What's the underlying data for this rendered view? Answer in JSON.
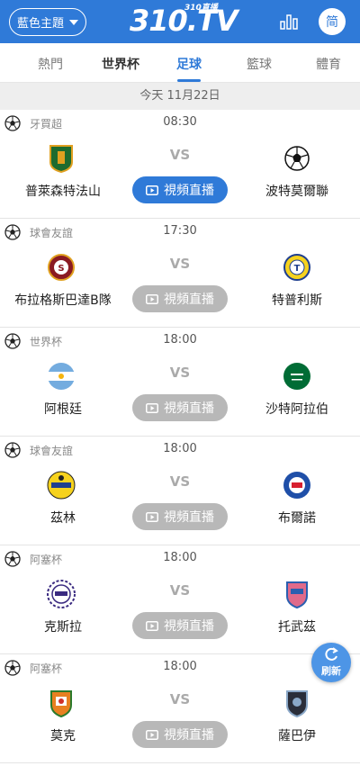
{
  "header": {
    "theme_label": "藍色主題",
    "logo_text": "310.TV",
    "logo_sub": "310直播",
    "lang_label": "简"
  },
  "tabs": [
    "熱門",
    "世界杯",
    "足球",
    "籃球",
    "體育"
  ],
  "active_tab": "足球",
  "date_label": "今天 11月22日",
  "live_label": "視頻直播",
  "vs_label": "VS",
  "refresh_label": "刷新",
  "colors": {
    "brand": "#2f7ad8",
    "button_off": "#b8b8b8"
  },
  "matches": [
    {
      "league": "牙買超",
      "time": "08:30",
      "home": "普萊森特法山",
      "away": "波特莫爾聯",
      "live": true,
      "home_icon": "green-shield-crest-icon",
      "away_icon": "soccer-ball-crest-icon"
    },
    {
      "league": "球會友誼",
      "time": "17:30",
      "home": "布拉格斯巴達B隊",
      "away": "特普利斯",
      "live": false,
      "home_icon": "sparta-red-crest-icon",
      "away_icon": "yellow-round-crest-icon"
    },
    {
      "league": "世界杯",
      "time": "18:00",
      "home": "阿根廷",
      "away": "沙特阿拉伯",
      "live": false,
      "home_icon": "argentina-flag-icon",
      "away_icon": "saudi-flag-icon"
    },
    {
      "league": "球會友誼",
      "time": "18:00",
      "home": "茲林",
      "away": "布爾諾",
      "live": false,
      "home_icon": "yellow-crest-icon",
      "away_icon": "blue-red-crest-icon"
    },
    {
      "league": "阿塞杯",
      "time": "18:00",
      "home": "克斯拉",
      "away": "托武茲",
      "live": false,
      "home_icon": "inter-crest-icon",
      "away_icon": "pink-shield-crest-icon"
    },
    {
      "league": "阿塞杯",
      "time": "18:00",
      "home": "莫克",
      "away": "薩巴伊",
      "live": false,
      "home_icon": "orange-shield-crest-icon",
      "away_icon": "dark-shield-crest-icon"
    }
  ]
}
